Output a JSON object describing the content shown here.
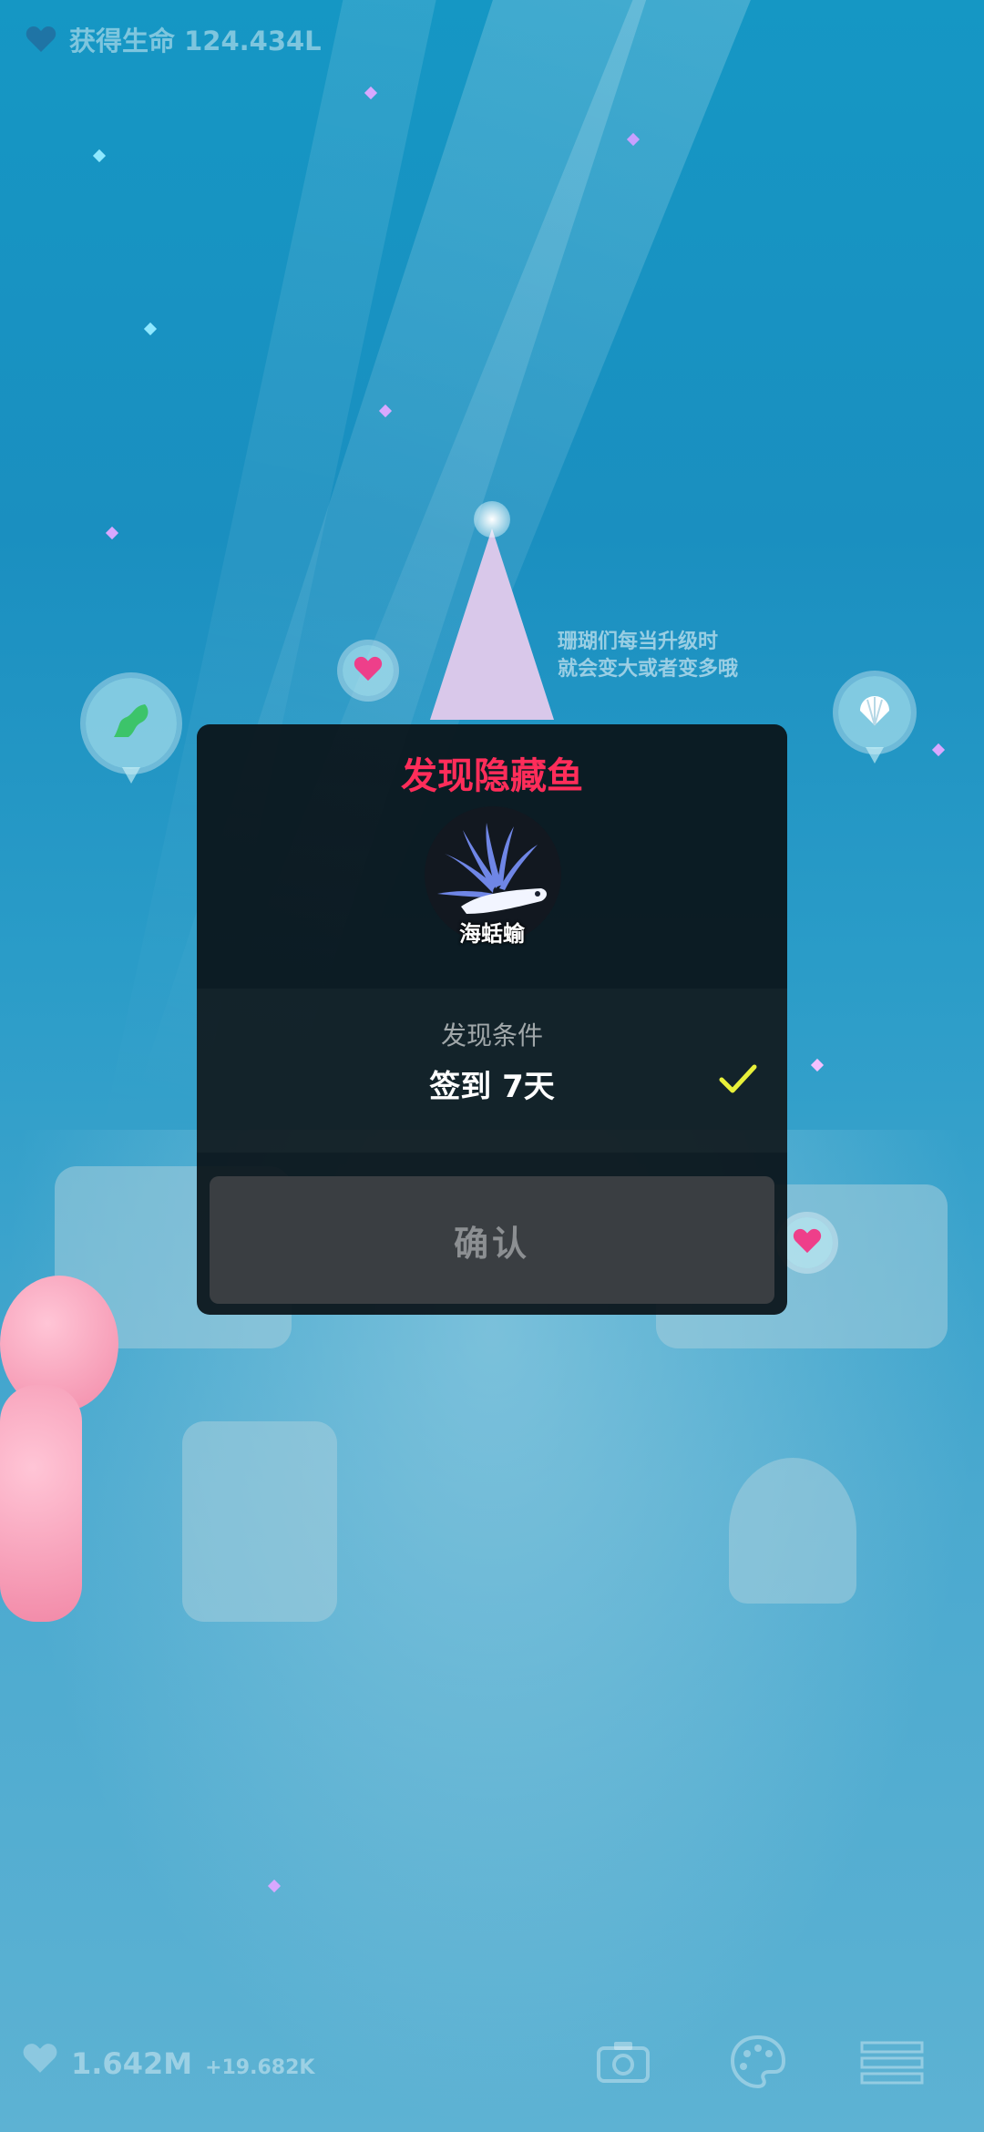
{
  "top": {
    "life_label": "获得生命 124.434L"
  },
  "scene": {
    "tip_line1": "珊瑚们每当升级时",
    "tip_line2": "就会变大或者变多哦"
  },
  "dialog": {
    "title": "发现隐藏鱼",
    "fish_name": "海蛞蝓",
    "condition_label": "发现条件",
    "condition_value": "签到 7天",
    "condition_met": true,
    "confirm_label": "确认"
  },
  "bottom": {
    "life_total": "1.642M",
    "life_rate": "+19.682K",
    "icons": [
      "camera-icon",
      "palette-icon",
      "list-icon"
    ]
  },
  "colors": {
    "title": "#ff2d5a",
    "check": "#e8f03a",
    "water": "#1a8fc0"
  }
}
